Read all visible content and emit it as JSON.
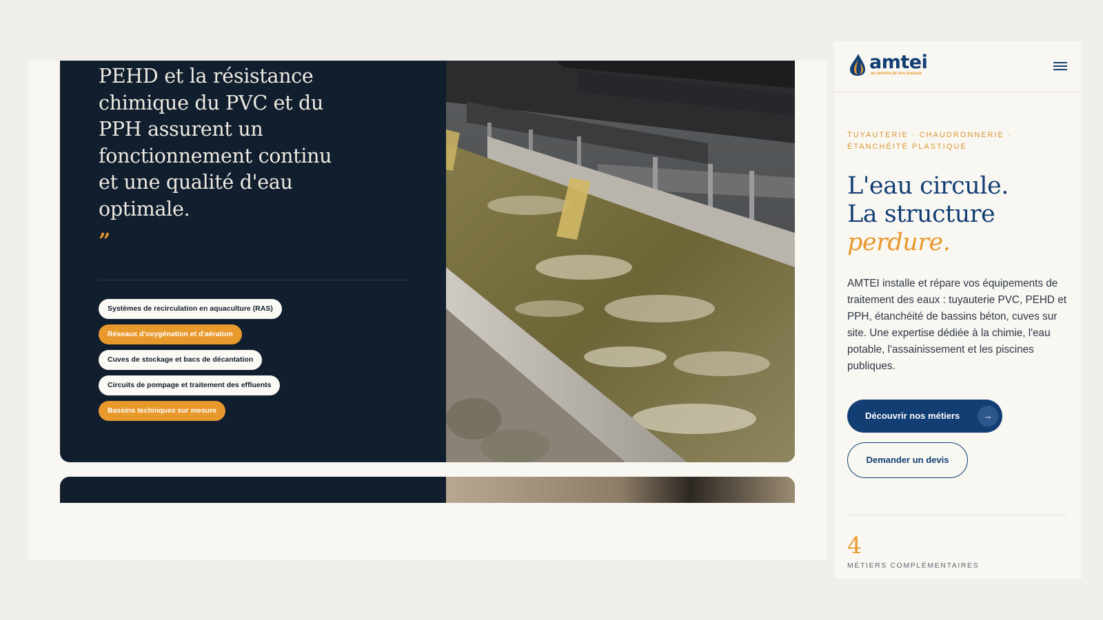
{
  "desktop": {
    "quote_text": "PEHD et la résistance chimique du PVC et du PPH assurent un fonctionnement continu et une qualité d'eau optimale.",
    "quote_mark": "”",
    "tags": [
      {
        "label": "Systèmes de recirculation en aquaculture (RAS)",
        "style": "light"
      },
      {
        "label": "Réseaux d'oxygénation et d'aération",
        "style": "accent"
      },
      {
        "label": "Cuves de stockage et bacs de décantation",
        "style": "light"
      },
      {
        "label": "Circuits de pompage et traitement des effluents",
        "style": "light"
      },
      {
        "label": "Bassins techniques sur mesure",
        "style": "accent"
      }
    ]
  },
  "mobile": {
    "logo": {
      "name": "amtei",
      "tagline": "au service de vos réseaux"
    },
    "eyebrow_line1": "TUYAUTERIE · CHAUDRONNERIE ·",
    "eyebrow_line2": "ÉTANCHÉITÉ PLASTIQUE",
    "headline_line1": "L'eau circule.",
    "headline_line2": "La structure",
    "headline_accent": "perdure.",
    "intro": "AMTEI installe et répare vos équipements de traitement des eaux : tuyauterie PVC, PEHD et PPH, étanchéité de bassins béton, cuves sur site. Une expertise dédiée à la chimie, l'eau potable, l'assainissement et les piscines publiques.",
    "primary_cta": "Découvrir nos métiers",
    "primary_cta_arrow": "→",
    "secondary_cta": "Demander un devis",
    "stat_number": "4",
    "stat_label": "MÉTIERS COMPLÉMENTAIRES"
  },
  "colors": {
    "navy": "#123e74",
    "dark_card": "#111e2e",
    "accent_orange": "#e8992c",
    "cream": "#f9f7f2"
  },
  "icons": [
    "water-drop-logo-icon",
    "hamburger-menu-icon",
    "arrow-right-icon",
    "quote-close-icon"
  ]
}
